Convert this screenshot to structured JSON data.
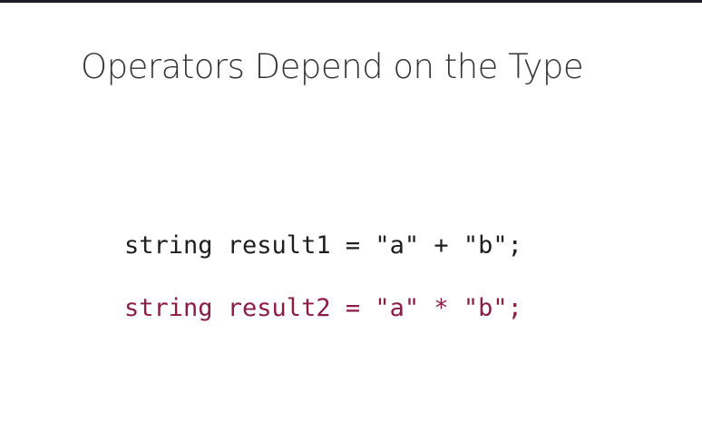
{
  "slide": {
    "title": "Operators Depend on the Type",
    "code_lines": [
      "string result1 = \"a\" + \"b\";",
      "string result2 = \"a\" * \"b\";"
    ]
  },
  "colors": {
    "top_bar": "#1a1a2a",
    "title": "#333333",
    "code_normal": "#1f1f1f",
    "code_error": "#8b1d44",
    "background": "#ffffff"
  }
}
